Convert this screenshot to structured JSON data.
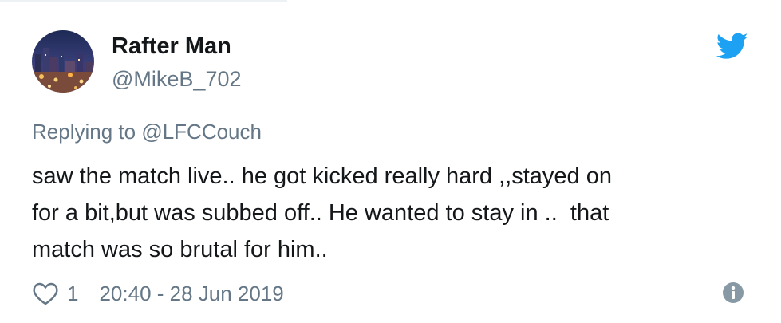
{
  "author": {
    "display_name": "Rafter Man",
    "handle": "@MikeB_702"
  },
  "reply": {
    "prefix": "Replying to",
    "mention": "@LFCCouch"
  },
  "tweet": {
    "lines": [
      "saw the match live.. he got kicked really hard ,,stayed on",
      "for a bit,but was subbed off.. He wanted to stay in ..  that",
      "match was so brutal for him.."
    ]
  },
  "footer": {
    "like_count": "1",
    "timestamp": "20:40 - 28 Jun 2019"
  },
  "icons": {
    "brand": "twitter-bird-icon",
    "like": "heart-icon",
    "info": "info-icon"
  },
  "colors": {
    "twitter_blue": "#1da1f2",
    "text": "#14171a",
    "secondary": "#657786",
    "info_icon": "#8899a6"
  }
}
